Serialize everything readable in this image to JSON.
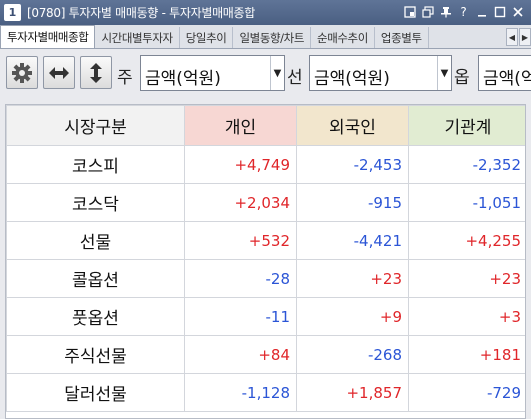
{
  "window": {
    "number": "1",
    "title": "[0780] 투자자별 매매동향 - 투자자별매매종합"
  },
  "tabs": [
    {
      "label": "투자자별매매종합",
      "active": true
    },
    {
      "label": "시간대별투자자",
      "active": false
    },
    {
      "label": "당일추이",
      "active": false
    },
    {
      "label": "일별동향/차트",
      "active": false
    },
    {
      "label": "순매수추이",
      "active": false
    },
    {
      "label": "업종별투",
      "active": false
    }
  ],
  "toolbar": {
    "label_stock": "주",
    "stock_value": "금액(억원)",
    "label_futures": "선",
    "futures_value": "금액(억원)",
    "label_options": "옵",
    "options_value": "금액(억원"
  },
  "grid": {
    "headers": [
      "시장구분",
      "개인",
      "외국인",
      "기관계"
    ],
    "rows": [
      {
        "name": "코스피",
        "values": [
          "+4,749",
          "-2,453",
          "-2,352"
        ]
      },
      {
        "name": "코스닥",
        "values": [
          "+2,034",
          "-915",
          "-1,051"
        ]
      },
      {
        "name": "선물",
        "values": [
          "+532",
          "-4,421",
          "+4,255"
        ]
      },
      {
        "name": "콜옵션",
        "values": [
          "-28",
          "+23",
          "+23"
        ]
      },
      {
        "name": "풋옵션",
        "values": [
          "-11",
          "+9",
          "+3"
        ]
      },
      {
        "name": "주식선물",
        "values": [
          "+84",
          "-268",
          "+181"
        ]
      },
      {
        "name": "달러선물",
        "values": [
          "-1,128",
          "+1,857",
          "-729"
        ]
      }
    ]
  },
  "colors": {
    "positive": "#e0262a",
    "negative": "#2b55d6"
  }
}
